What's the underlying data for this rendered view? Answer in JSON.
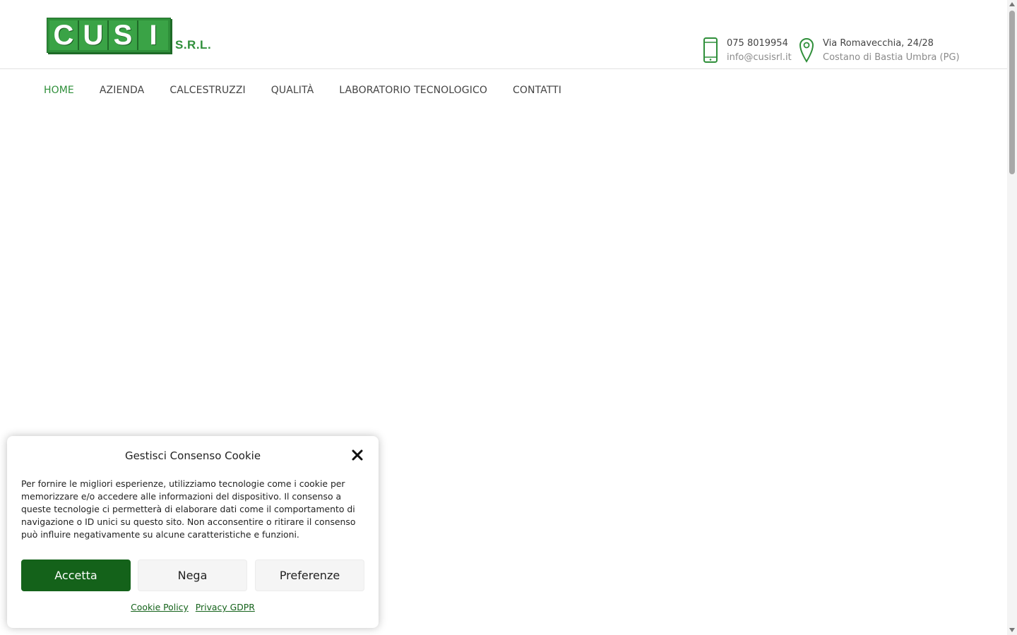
{
  "brand": {
    "logo_letters": [
      "C",
      "U",
      "S",
      "I"
    ],
    "logo_suffix": "S.R.L.",
    "accent_color": "#2f8f3a"
  },
  "contacts": {
    "phone": {
      "icon": "smartphone-icon",
      "number": "075 8019954",
      "email": "info@cusisrl.it"
    },
    "address": {
      "icon": "map-pin-icon",
      "street": "Via Romavecchia, 24/28",
      "city": "Costano di Bastia Umbra (PG)"
    }
  },
  "nav": {
    "items": [
      {
        "label": "HOME",
        "active": true
      },
      {
        "label": "AZIENDA",
        "active": false
      },
      {
        "label": "CALCESTRUZZI",
        "active": false
      },
      {
        "label": "QUALITÀ",
        "active": false
      },
      {
        "label": "LABORATORIO TECNOLOGICO",
        "active": false
      },
      {
        "label": "CONTATTI",
        "active": false
      }
    ]
  },
  "cookie_modal": {
    "title": "Gestisci Consenso Cookie",
    "close_icon": "close-icon",
    "body": "Per fornire le migliori esperienze, utilizziamo tecnologie come i cookie per memorizzare e/o accedere alle informazioni del dispositivo. Il consenso a queste tecnologie ci permetterà di elaborare dati come il comportamento di navigazione o ID unici su questo sito. Non acconsentire o ritirare il consenso può influire negativamente su alcune caratteristiche e funzioni.",
    "buttons": {
      "accept": "Accetta",
      "deny": "Nega",
      "preferences": "Preferenze"
    },
    "links": {
      "cookie_policy": "Cookie Policy",
      "privacy": "Privacy GDPR"
    },
    "accept_color": "#14621a"
  }
}
